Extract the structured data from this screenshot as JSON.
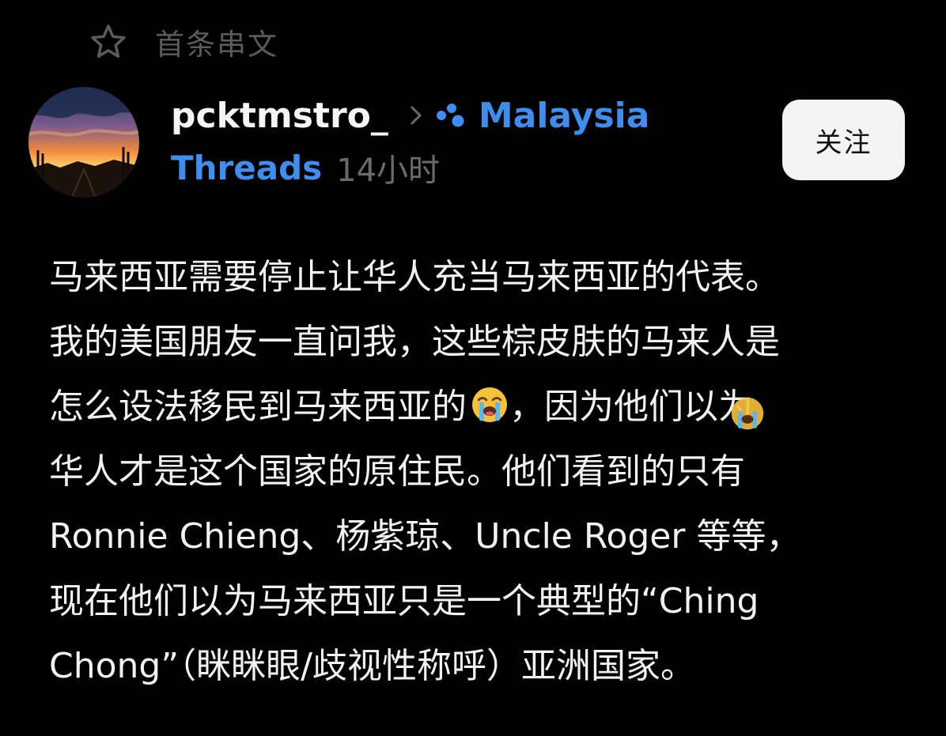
{
  "header": {
    "pinned_label": "首条串文",
    "pinned_icon": "star-icon"
  },
  "author": {
    "username": "pcktmstro_",
    "community": "Malaysia",
    "community_icon": "community-dots-icon",
    "source": "Threads",
    "time": "14小时",
    "avatar": "sunset-landscape-avatar"
  },
  "actions": {
    "follow_label": "关注"
  },
  "post": {
    "lines": [
      "马来西亚需要停止让华人充当马来西亚的代表。",
      "我的美国朋友一直问我，这些棕皮肤的马来人是",
      "怎么设法移民到马来西亚的",
      "，因为他们以为",
      "华人才是这个国家的原住民。他们看到的只有",
      "Ronnie Chieng、杨紫琼、Uncle Roger 等等，",
      "现在他们以为马来西亚只是一个典型的“Ching",
      "Chong”（眯眯眼/歧视性称呼）亚洲国家。"
    ],
    "emoji": "loudly-crying-face-emoji"
  },
  "colors": {
    "background": "#000000",
    "accent": "#3e8ef0",
    "muted": "#6b6b6b",
    "button_bg": "#f4f4f4"
  }
}
